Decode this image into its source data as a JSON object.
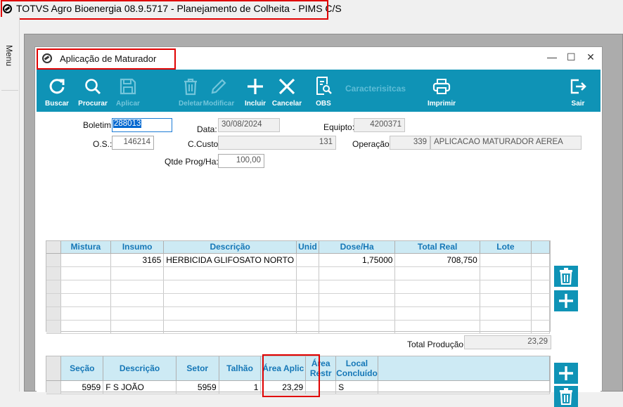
{
  "app": {
    "title": "TOTVS Agro Bioenergia 08.9.5717 - Planejamento de Colheita - PIMS C/S"
  },
  "side_menu": {
    "label": "Menu"
  },
  "window": {
    "title": "Aplicação de Maturador"
  },
  "window_buttons": {
    "minimize": "—",
    "maximize": "☐",
    "close": "✕"
  },
  "toolbar": {
    "buscar": "Buscar",
    "procurar": "Procurar",
    "aplicar": "Aplicar",
    "deletar": "Deletar",
    "modificar": "Modificar",
    "incluir": "Incluir",
    "cancelar": "Cancelar",
    "obs": "OBS",
    "caracteristicas": "Caracterisitcas",
    "imprimir": "Imprimir",
    "sair": "Sair"
  },
  "header": {
    "boletim_label": "Boletim:",
    "boletim_value": "288013",
    "data_label": "Data:",
    "data_value": "30/08/2024",
    "equipto_label": "Equipto:",
    "equipto_value": "4200371",
    "os_label": "O.S.:",
    "os_value": "146214",
    "ccusto_label": "C.Custo:",
    "ccusto_value": "131",
    "operacao_label": "Operação:",
    "operacao_code": "339",
    "operacao_desc": "APLICACAO MATURADOR AEREA",
    "qtde_label": "Qtde Prog/Ha:",
    "qtde_value": "100,00"
  },
  "insumos_grid": {
    "columns": [
      "Mistura",
      "Insumo",
      "Descrição",
      "Unid",
      "Dose/Ha",
      "Total Real",
      "Lote"
    ],
    "rows": [
      [
        "",
        "3165",
        "HERBICIDA GLIFOSATO NORTO",
        "",
        "1,75000",
        "708,750",
        ""
      ]
    ]
  },
  "total_producao": {
    "label": "Total Produção:",
    "value": "23,29"
  },
  "secoes_grid": {
    "columns": [
      "Seção",
      "Descrição",
      "Setor",
      "Talhão",
      "Área Aplic",
      "Área Restr",
      "Local Concluído"
    ],
    "rows": [
      [
        "5959",
        "F S JOÃO",
        "5959",
        "1",
        "23,29",
        "",
        "S"
      ]
    ]
  }
}
